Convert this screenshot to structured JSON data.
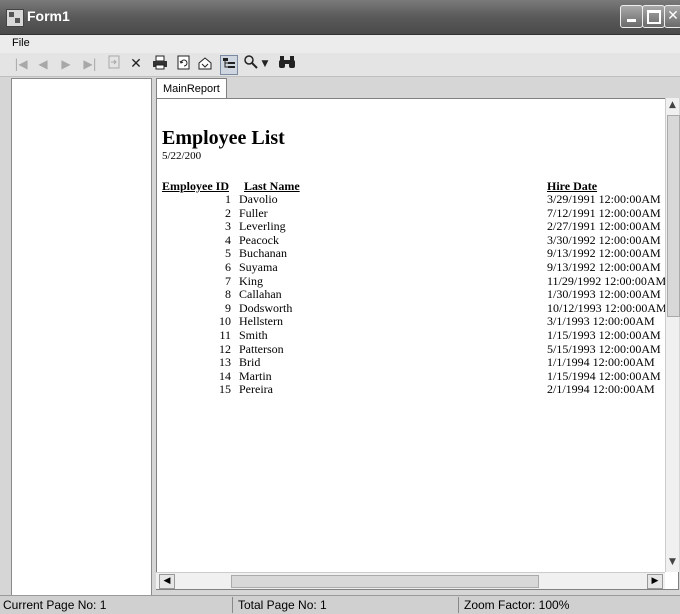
{
  "window": {
    "title": "Form1"
  },
  "menu": {
    "file": "File"
  },
  "toolbar": {
    "icons": [
      "first-page-icon",
      "previous-page-icon",
      "next-page-icon",
      "last-page-icon",
      "goto-page-icon",
      "close-icon",
      "print-icon",
      "refresh-icon",
      "export-icon",
      "tree-toggle-icon",
      "zoom-icon",
      "dropdown-arrow-icon",
      "search-icon"
    ]
  },
  "tab": {
    "label": "MainReport"
  },
  "report": {
    "title": "Employee List",
    "date": "5/22/200",
    "headers": {
      "id": "Employee ID",
      "last_name": "Last Name",
      "hire_date": "Hire Date"
    },
    "rows": [
      {
        "id": "1",
        "name": "Davolio",
        "date": "3/29/1991  12:00:00AM"
      },
      {
        "id": "2",
        "name": "Fuller",
        "date": "7/12/1991  12:00:00AM"
      },
      {
        "id": "3",
        "name": "Leverling",
        "date": "2/27/1991  12:00:00AM"
      },
      {
        "id": "4",
        "name": "Peacock",
        "date": "3/30/1992  12:00:00AM"
      },
      {
        "id": "5",
        "name": "Buchanan",
        "date": "9/13/1992  12:00:00AM"
      },
      {
        "id": "6",
        "name": "Suyama",
        "date": "9/13/1992  12:00:00AM"
      },
      {
        "id": "7",
        "name": "King",
        "date": "11/29/1992  12:00:00AM"
      },
      {
        "id": "8",
        "name": "Callahan",
        "date": "1/30/1993  12:00:00AM"
      },
      {
        "id": "9",
        "name": "Dodsworth",
        "date": "10/12/1993  12:00:00AM"
      },
      {
        "id": "10",
        "name": "Hellstern",
        "date": "3/1/1993  12:00:00AM"
      },
      {
        "id": "11",
        "name": "Smith",
        "date": "1/15/1993  12:00:00AM"
      },
      {
        "id": "12",
        "name": "Patterson",
        "date": "5/15/1993  12:00:00AM"
      },
      {
        "id": "13",
        "name": "Brid",
        "date": "1/1/1994  12:00:00AM"
      },
      {
        "id": "14",
        "name": "Martin",
        "date": "1/15/1994  12:00:00AM"
      },
      {
        "id": "15",
        "name": "Pereira",
        "date": "2/1/1994  12:00:00AM"
      }
    ]
  },
  "status": {
    "current_page": "Current Page No: 1",
    "total_page": "Total Page No: 1",
    "zoom": "Zoom Factor: 100%"
  }
}
